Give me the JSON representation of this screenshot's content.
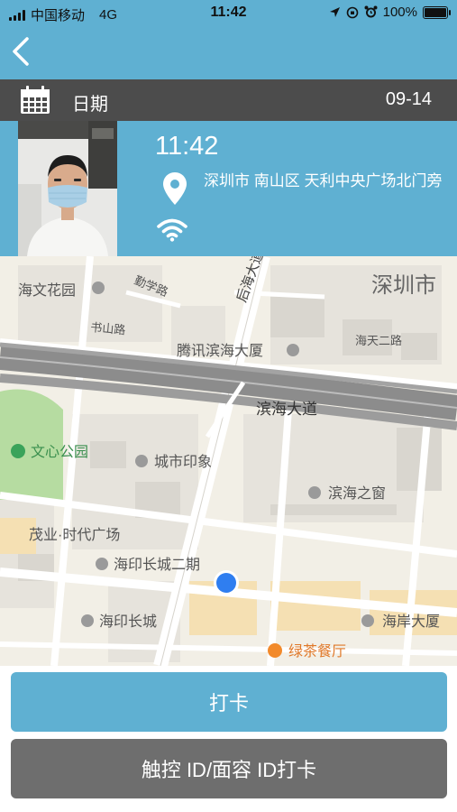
{
  "status_bar": {
    "carrier": "中国移动",
    "network": "4G",
    "time": "11:42",
    "battery": "100%"
  },
  "header": {
    "back_icon": "chevron-left-icon"
  },
  "date_row": {
    "icon": "calendar-icon",
    "label": "日期",
    "value": "09-14"
  },
  "record": {
    "photo": "user-face-photo",
    "time": "11:42",
    "location": "深圳市 南山区 天利中央广场北门旁",
    "wifi_icon": "wifi-icon"
  },
  "map": {
    "labels": [
      {
        "name": "haiwen-huayuan",
        "text": "海文花园"
      },
      {
        "name": "qinxue-road",
        "text": "勤学路"
      },
      {
        "name": "houhai-avenue",
        "text": "后海大道"
      },
      {
        "name": "shenzhen-city",
        "text": "深圳市"
      },
      {
        "name": "shushan-road",
        "text": "书山路"
      },
      {
        "name": "tencent-building",
        "text": "腾讯滨海大厦"
      },
      {
        "name": "haitian-road-2",
        "text": "海天二路"
      },
      {
        "name": "binhai-avenue",
        "text": "滨海大道"
      },
      {
        "name": "wenxin-park",
        "text": "文心公园"
      },
      {
        "name": "city-impression",
        "text": "城市印象"
      },
      {
        "name": "binhai-window",
        "text": "滨海之窗"
      },
      {
        "name": "maoye-plaza",
        "text": "茂业·时代广场"
      },
      {
        "name": "haiyin-2",
        "text": "海印长城二期"
      },
      {
        "name": "haiyin",
        "text": "海印长城"
      },
      {
        "name": "haian-building",
        "text": "海岸大厦"
      },
      {
        "name": "green-tea",
        "text": "绿茶餐厅"
      }
    ],
    "colors": {
      "road": "#ffffff",
      "expressway": "#8c8c8c",
      "block": "#e6e3dc",
      "building": "#d9d6cf",
      "park": "#b6dca1",
      "mall": "#f5e0b3",
      "location_dot": "#2f7ef0"
    }
  },
  "buttons": {
    "clock_in": "打卡",
    "biometric_clock_in": "触控 ID/面容 ID打卡"
  },
  "theme": {
    "header_blue": "#5fb0d2",
    "date_bar_gray": "#4c4c4c",
    "button_gray": "#6e6e6e"
  }
}
